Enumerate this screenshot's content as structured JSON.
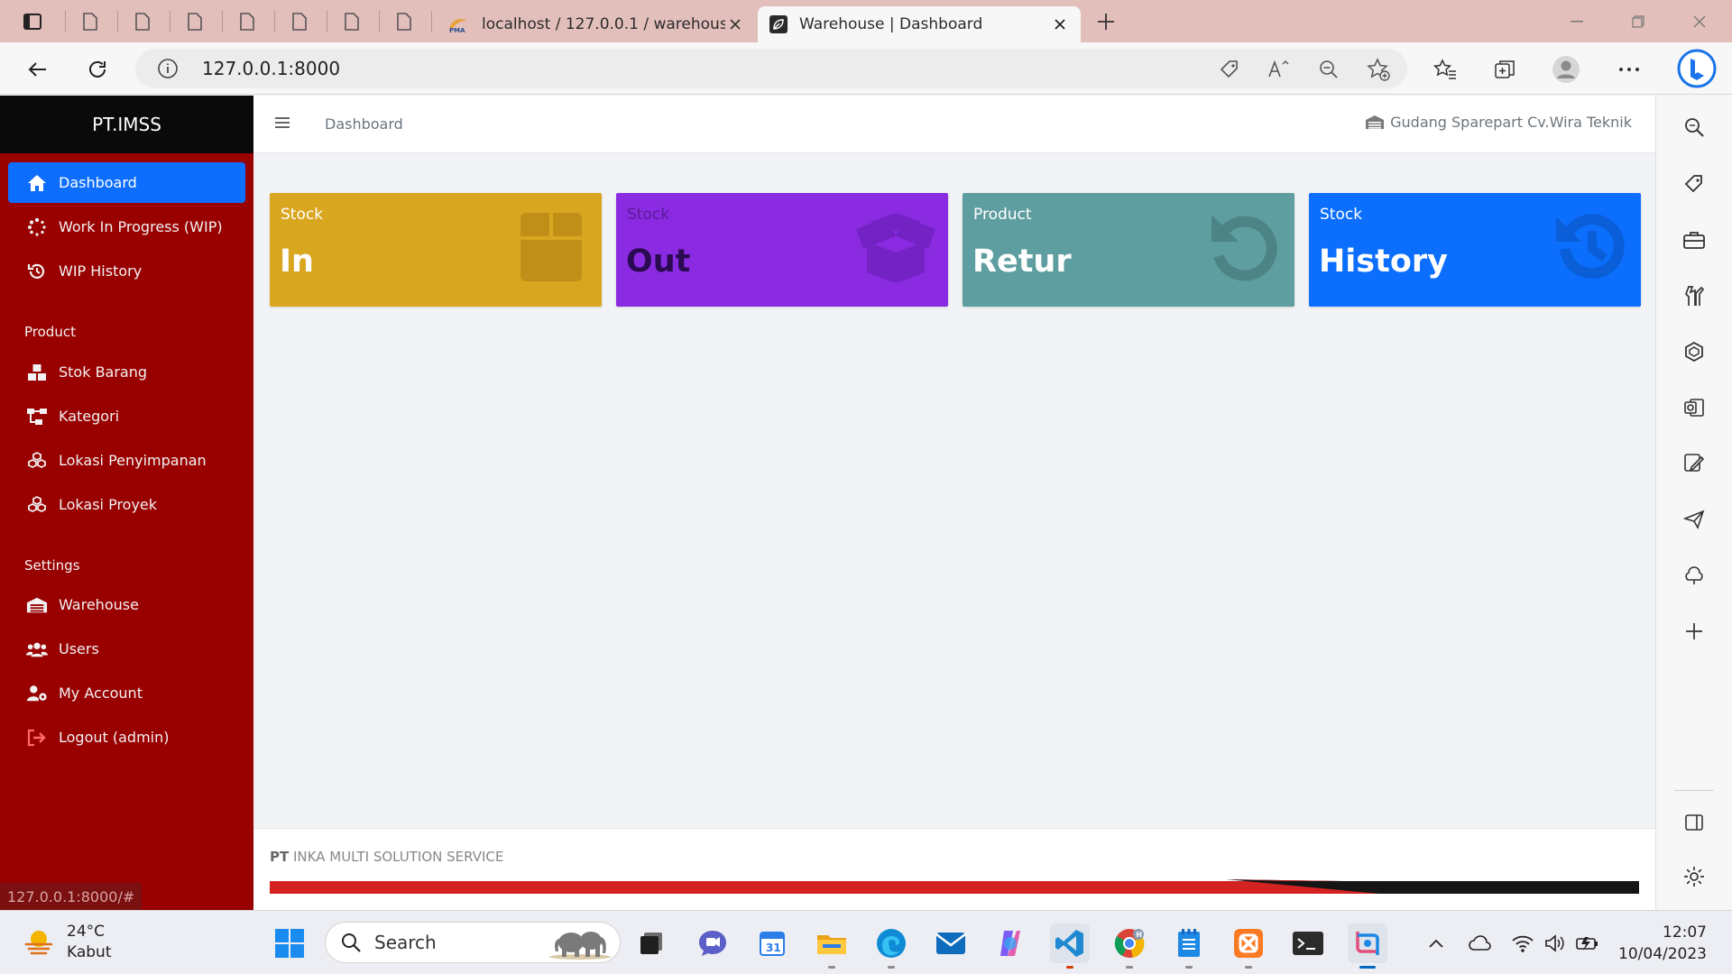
{
  "browser": {
    "tabs": [
      {
        "title": "localhost / 127.0.0.1 / warehouse",
        "active": false
      },
      {
        "title": "Warehouse | Dashboard",
        "active": true
      }
    ],
    "address": "127.0.0.1:8000"
  },
  "app": {
    "brand": "PT.IMSS",
    "breadcrumb": "Dashboard",
    "warehouse_name": "Gudang Sparepart Cv.Wira Teknik",
    "sidebar": {
      "items": [
        {
          "label": "Dashboard",
          "icon": "home-icon",
          "active": true
        },
        {
          "label": "Work In Progress (WIP)",
          "icon": "spinner-icon"
        },
        {
          "label": "WIP History",
          "icon": "history-icon"
        }
      ],
      "product_header": "Product",
      "product_items": [
        {
          "label": "Stok Barang",
          "icon": "boxes-icon"
        },
        {
          "label": "Kategori",
          "icon": "sitemap-icon"
        },
        {
          "label": "Lokasi Penyimpanan",
          "icon": "cubes-icon"
        },
        {
          "label": "Lokasi Proyek",
          "icon": "cubes-icon"
        }
      ],
      "settings_header": "Settings",
      "settings_items": [
        {
          "label": "Warehouse",
          "icon": "warehouse-icon"
        },
        {
          "label": "Users",
          "icon": "users-icon"
        },
        {
          "label": "My Account",
          "icon": "user-cog-icon"
        },
        {
          "label": "Logout (admin)",
          "icon": "logout-icon"
        }
      ]
    },
    "cards": [
      {
        "small": "Stock",
        "big": "In",
        "icon": "box-icon",
        "color": "#d9a61f"
      },
      {
        "small": "Stock",
        "big": "Out",
        "icon": "box-open-icon",
        "color": "#8a2be2"
      },
      {
        "small": "Product",
        "big": "Retur",
        "icon": "undo-icon",
        "color": "#5f9ea0"
      },
      {
        "small": "Stock",
        "big": "History",
        "icon": "history-icon",
        "color": "#0b6efd"
      }
    ],
    "footer": {
      "company_bold": "PT",
      "company_rest": " INKA MULTI SOLUTION SERVICE"
    },
    "status_url": "127.0.0.1:8000/#"
  },
  "taskbar": {
    "weather_temp": "24°C",
    "weather_desc": "Kabut",
    "search_label": "Search",
    "time": "12:07",
    "date": "10/04/2023"
  },
  "colors": {
    "sidebar": "#990000",
    "brand_bar": "#0a0a0a",
    "active_item": "#0d6efd"
  }
}
